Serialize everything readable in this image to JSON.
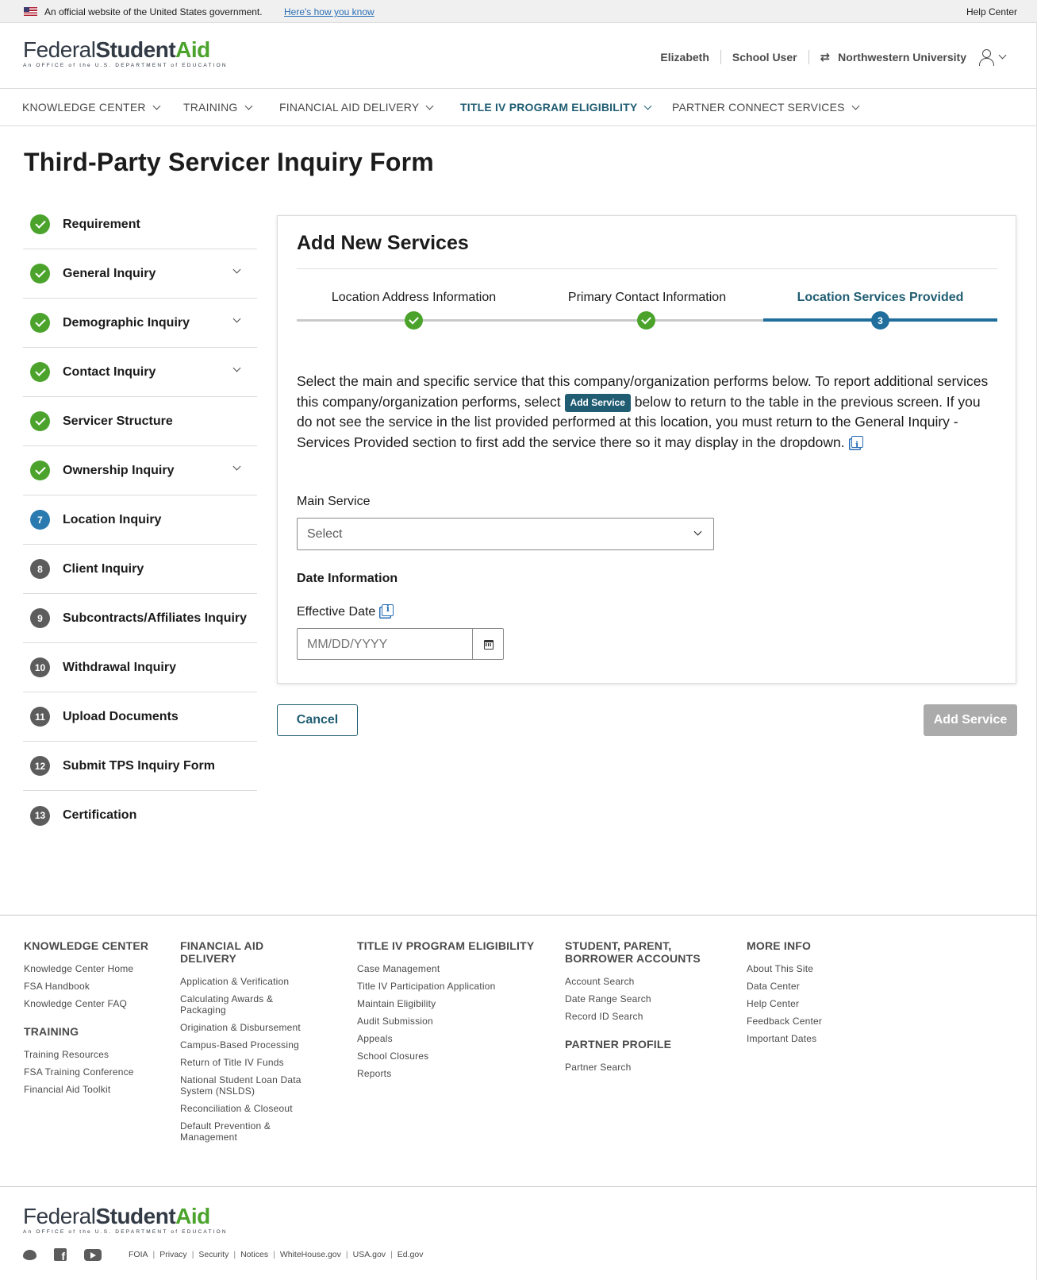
{
  "gov_banner": {
    "text": "An official website of the United States government.",
    "link": "Here's how you know",
    "help": "Help Center"
  },
  "logo": {
    "word1": "Federal",
    "word2": "Student",
    "word3": "Aid",
    "tagline": "An OFFICE of the U.S. DEPARTMENT of EDUCATION"
  },
  "user": {
    "name": "Elizabeth",
    "role": "School User",
    "org": "Northwestern University"
  },
  "nav": [
    {
      "label": "KNOWLEDGE CENTER"
    },
    {
      "label": "TRAINING"
    },
    {
      "label": "FINANCIAL AID DELIVERY"
    },
    {
      "label": "TITLE IV PROGRAM ELIGIBILITY"
    },
    {
      "label": "PARTNER CONNECT SERVICES"
    }
  ],
  "page_title": "Third-Party Servicer Inquiry Form",
  "sidebar": [
    {
      "label": "Requirement",
      "num": ""
    },
    {
      "label": "General Inquiry",
      "num": ""
    },
    {
      "label": "Demographic Inquiry",
      "num": ""
    },
    {
      "label": "Contact Inquiry",
      "num": ""
    },
    {
      "label": "Servicer Structure",
      "num": ""
    },
    {
      "label": "Ownership Inquiry",
      "num": ""
    },
    {
      "label": "Location Inquiry",
      "num": "7"
    },
    {
      "label": "Client Inquiry",
      "num": "8"
    },
    {
      "label": "Subcontracts/Affiliates Inquiry",
      "num": "9"
    },
    {
      "label": "Withdrawal Inquiry",
      "num": "10"
    },
    {
      "label": "Upload Documents",
      "num": "11"
    },
    {
      "label": "Submit TPS Inquiry Form",
      "num": "12"
    },
    {
      "label": "Certification",
      "num": "13"
    }
  ],
  "card": {
    "title": "Add New Services",
    "stepper": [
      {
        "label": "Location Address Information"
      },
      {
        "label": "Primary Contact Information"
      },
      {
        "label": "Location Services Provided",
        "num": "3"
      }
    ],
    "instructions_part1": "Select the main and specific service that this company/organization performs below.  To report additional services this company/organization performs, select",
    "instructions_chip": "Add Service",
    "instructions_part2": "below to return to the table in the previous screen.  If you do not see the service in the list provided performed at this location, you must return to the General Inquiry - Services Provided section to first add the service there so it may display in the dropdown.",
    "main_service_label": "Main Service",
    "main_service_value": "Select",
    "date_section": "Date Information",
    "effective_date_label": "Effective Date",
    "effective_date_placeholder": "MM/DD/YYYY"
  },
  "buttons": {
    "cancel": "Cancel",
    "add_service": "Add Service"
  },
  "footer": {
    "col1": {
      "head": "KNOWLEDGE CENTER",
      "links": [
        "Knowledge Center Home",
        "FSA Handbook",
        "Knowledge Center FAQ"
      ],
      "head2": "TRAINING",
      "links2": [
        "Training Resources",
        "FSA Training Conference",
        "Financial Aid Toolkit"
      ]
    },
    "col2": {
      "head": "FINANCIAL AID DELIVERY",
      "links": [
        "Application & Verification",
        "Calculating Awards & Packaging",
        "Origination & Disbursement",
        "Campus-Based Processing",
        "Return of Title IV Funds",
        "National Student Loan Data System (NSLDS)",
        "Reconciliation & Closeout",
        "Default Prevention & Management"
      ]
    },
    "col3": {
      "head": "TITLE IV PROGRAM ELIGIBILITY",
      "links": [
        "Case Management",
        "Title IV Participation Application",
        "Maintain Eligibility",
        "Audit Submission",
        "Appeals",
        "School Closures",
        "Reports"
      ]
    },
    "col4": {
      "head": "STUDENT, PARENT, BORROWER ACCOUNTS",
      "links": [
        "Account Search",
        "Date Range Search",
        "Record ID Search"
      ],
      "head2": "PARTNER PROFILE",
      "links2": [
        "Partner Search"
      ]
    },
    "col5": {
      "head": "MORE INFO",
      "links": [
        "About This Site",
        "Data Center",
        "Help Center",
        "Feedback Center",
        "Important Dates"
      ]
    },
    "legal": [
      "FOIA",
      "Privacy",
      "Security",
      "Notices",
      "WhiteHouse.gov",
      "USA.gov",
      "Ed.gov"
    ]
  },
  "colors": {
    "brand_green": "#4ba32c",
    "brand_teal": "#205d72",
    "step_blue": "#1f6e9c",
    "disabled_gray": "#ababab"
  }
}
